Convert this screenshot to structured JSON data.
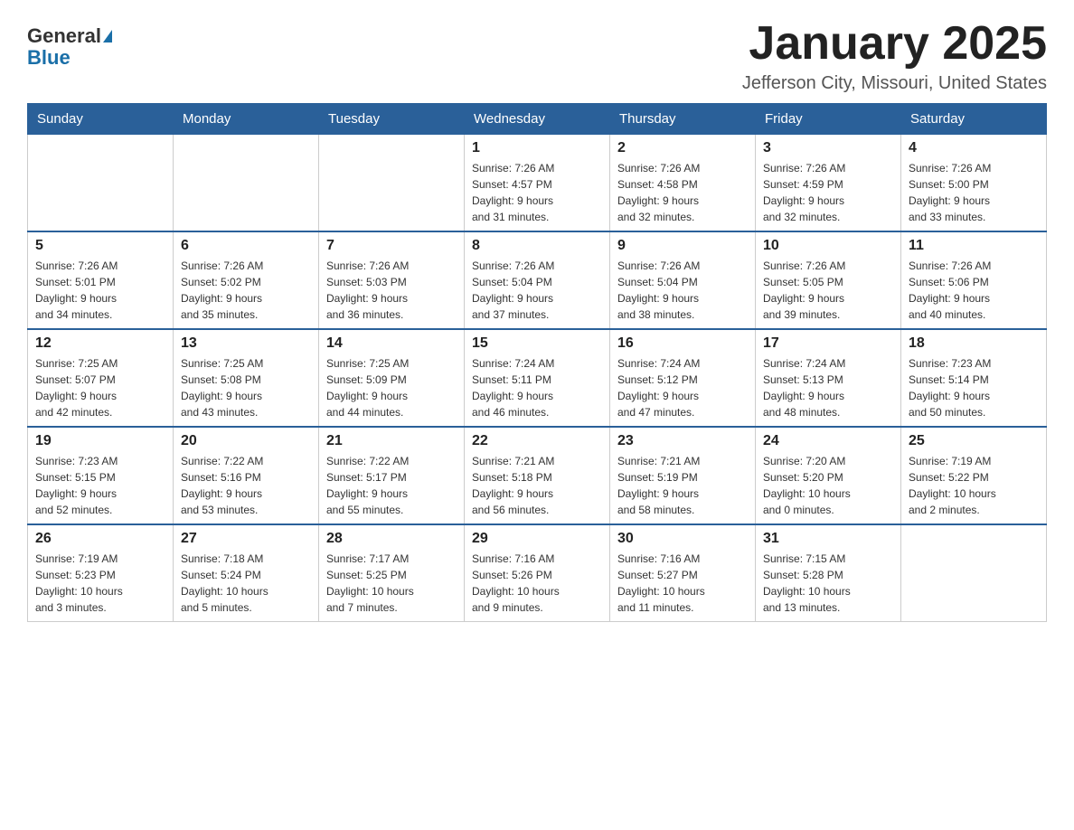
{
  "header": {
    "logo_general": "General",
    "logo_blue": "Blue",
    "title": "January 2025",
    "location": "Jefferson City, Missouri, United States"
  },
  "days_of_week": [
    "Sunday",
    "Monday",
    "Tuesday",
    "Wednesday",
    "Thursday",
    "Friday",
    "Saturday"
  ],
  "weeks": [
    [
      {
        "day": "",
        "info": ""
      },
      {
        "day": "",
        "info": ""
      },
      {
        "day": "",
        "info": ""
      },
      {
        "day": "1",
        "info": "Sunrise: 7:26 AM\nSunset: 4:57 PM\nDaylight: 9 hours\nand 31 minutes."
      },
      {
        "day": "2",
        "info": "Sunrise: 7:26 AM\nSunset: 4:58 PM\nDaylight: 9 hours\nand 32 minutes."
      },
      {
        "day": "3",
        "info": "Sunrise: 7:26 AM\nSunset: 4:59 PM\nDaylight: 9 hours\nand 32 minutes."
      },
      {
        "day": "4",
        "info": "Sunrise: 7:26 AM\nSunset: 5:00 PM\nDaylight: 9 hours\nand 33 minutes."
      }
    ],
    [
      {
        "day": "5",
        "info": "Sunrise: 7:26 AM\nSunset: 5:01 PM\nDaylight: 9 hours\nand 34 minutes."
      },
      {
        "day": "6",
        "info": "Sunrise: 7:26 AM\nSunset: 5:02 PM\nDaylight: 9 hours\nand 35 minutes."
      },
      {
        "day": "7",
        "info": "Sunrise: 7:26 AM\nSunset: 5:03 PM\nDaylight: 9 hours\nand 36 minutes."
      },
      {
        "day": "8",
        "info": "Sunrise: 7:26 AM\nSunset: 5:04 PM\nDaylight: 9 hours\nand 37 minutes."
      },
      {
        "day": "9",
        "info": "Sunrise: 7:26 AM\nSunset: 5:04 PM\nDaylight: 9 hours\nand 38 minutes."
      },
      {
        "day": "10",
        "info": "Sunrise: 7:26 AM\nSunset: 5:05 PM\nDaylight: 9 hours\nand 39 minutes."
      },
      {
        "day": "11",
        "info": "Sunrise: 7:26 AM\nSunset: 5:06 PM\nDaylight: 9 hours\nand 40 minutes."
      }
    ],
    [
      {
        "day": "12",
        "info": "Sunrise: 7:25 AM\nSunset: 5:07 PM\nDaylight: 9 hours\nand 42 minutes."
      },
      {
        "day": "13",
        "info": "Sunrise: 7:25 AM\nSunset: 5:08 PM\nDaylight: 9 hours\nand 43 minutes."
      },
      {
        "day": "14",
        "info": "Sunrise: 7:25 AM\nSunset: 5:09 PM\nDaylight: 9 hours\nand 44 minutes."
      },
      {
        "day": "15",
        "info": "Sunrise: 7:24 AM\nSunset: 5:11 PM\nDaylight: 9 hours\nand 46 minutes."
      },
      {
        "day": "16",
        "info": "Sunrise: 7:24 AM\nSunset: 5:12 PM\nDaylight: 9 hours\nand 47 minutes."
      },
      {
        "day": "17",
        "info": "Sunrise: 7:24 AM\nSunset: 5:13 PM\nDaylight: 9 hours\nand 48 minutes."
      },
      {
        "day": "18",
        "info": "Sunrise: 7:23 AM\nSunset: 5:14 PM\nDaylight: 9 hours\nand 50 minutes."
      }
    ],
    [
      {
        "day": "19",
        "info": "Sunrise: 7:23 AM\nSunset: 5:15 PM\nDaylight: 9 hours\nand 52 minutes."
      },
      {
        "day": "20",
        "info": "Sunrise: 7:22 AM\nSunset: 5:16 PM\nDaylight: 9 hours\nand 53 minutes."
      },
      {
        "day": "21",
        "info": "Sunrise: 7:22 AM\nSunset: 5:17 PM\nDaylight: 9 hours\nand 55 minutes."
      },
      {
        "day": "22",
        "info": "Sunrise: 7:21 AM\nSunset: 5:18 PM\nDaylight: 9 hours\nand 56 minutes."
      },
      {
        "day": "23",
        "info": "Sunrise: 7:21 AM\nSunset: 5:19 PM\nDaylight: 9 hours\nand 58 minutes."
      },
      {
        "day": "24",
        "info": "Sunrise: 7:20 AM\nSunset: 5:20 PM\nDaylight: 10 hours\nand 0 minutes."
      },
      {
        "day": "25",
        "info": "Sunrise: 7:19 AM\nSunset: 5:22 PM\nDaylight: 10 hours\nand 2 minutes."
      }
    ],
    [
      {
        "day": "26",
        "info": "Sunrise: 7:19 AM\nSunset: 5:23 PM\nDaylight: 10 hours\nand 3 minutes."
      },
      {
        "day": "27",
        "info": "Sunrise: 7:18 AM\nSunset: 5:24 PM\nDaylight: 10 hours\nand 5 minutes."
      },
      {
        "day": "28",
        "info": "Sunrise: 7:17 AM\nSunset: 5:25 PM\nDaylight: 10 hours\nand 7 minutes."
      },
      {
        "day": "29",
        "info": "Sunrise: 7:16 AM\nSunset: 5:26 PM\nDaylight: 10 hours\nand 9 minutes."
      },
      {
        "day": "30",
        "info": "Sunrise: 7:16 AM\nSunset: 5:27 PM\nDaylight: 10 hours\nand 11 minutes."
      },
      {
        "day": "31",
        "info": "Sunrise: 7:15 AM\nSunset: 5:28 PM\nDaylight: 10 hours\nand 13 minutes."
      },
      {
        "day": "",
        "info": ""
      }
    ]
  ]
}
